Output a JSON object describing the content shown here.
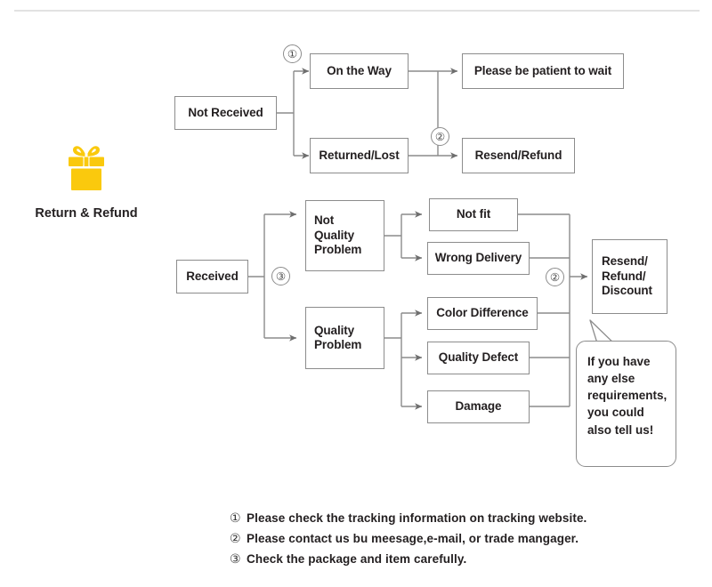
{
  "brand": {
    "icon": "gift-box-icon",
    "label": "Return & Refund",
    "color": "#fac90d"
  },
  "theme": {
    "line": "#8c8c8c",
    "text": "#231f20",
    "divider": "#e2e2e2",
    "accent": "#fac90d"
  },
  "flow": {
    "not_received": "Not Received",
    "on_the_way": "On the Way",
    "returned_lost": "Returned/Lost",
    "please_wait": "Please be patient to wait",
    "resend_refund": "Resend/Refund",
    "received": "Received",
    "not_quality_problem": "Not\nQuality\nProblem",
    "quality_problem": "Quality\nProblem",
    "not_fit": "Not fit",
    "wrong_delivery": "Wrong Delivery",
    "color_difference": "Color Difference",
    "quality_defect": "Quality Defect",
    "damage": "Damage",
    "resend_refund_discount": "Resend/\nRefund/\nDiscount"
  },
  "markers": {
    "m1": "①",
    "m2_top": "②",
    "m3": "③",
    "m2_bottom": "②"
  },
  "bubble": {
    "text": "If you have\nany else\nrequirements,\nyou could\nalso tell us!"
  },
  "notes": [
    {
      "num": "①",
      "text": "Please check the tracking information on tracking website."
    },
    {
      "num": "②",
      "text": "Please contact us bu meesage,e-mail, or trade mangager."
    },
    {
      "num": "③",
      "text": "Check the package and item carefully."
    }
  ]
}
